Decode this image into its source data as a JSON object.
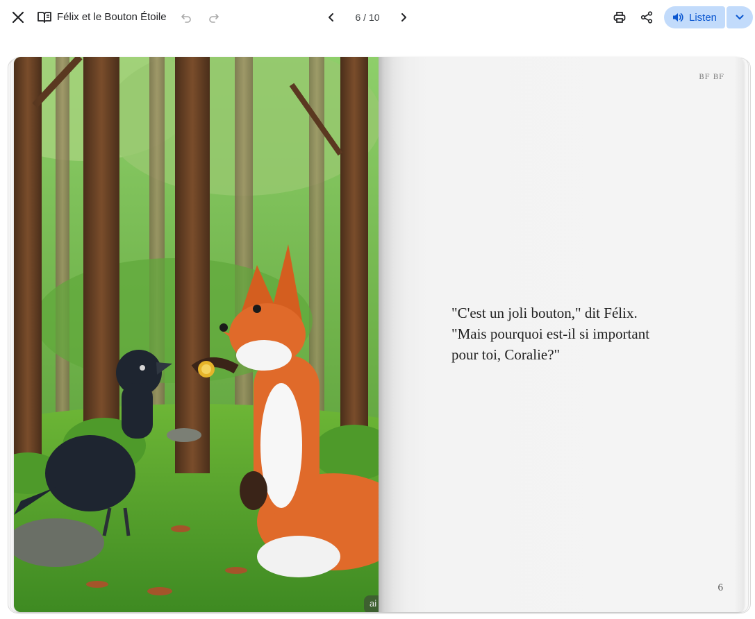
{
  "toolbar": {
    "book_title": "Félix et le Bouton Étoile",
    "page_counter": "6 / 10",
    "listen_label": "Listen",
    "icons": {
      "close": "close-icon",
      "book": "book-icon",
      "undo": "undo-icon",
      "redo": "redo-icon",
      "prev": "chevron-left-icon",
      "next": "chevron-right-icon",
      "print": "print-icon",
      "share": "share-icon",
      "listen": "speaker-icon",
      "listen_menu": "chevron-down-icon"
    },
    "colors": {
      "listen_bg": "#c2dbfb",
      "listen_fg": "#0b57d0"
    }
  },
  "book": {
    "left_page": {
      "illustration": "illustration-fox-and-crow-in-forest",
      "badge": "ai"
    },
    "right_page": {
      "corner_mark": "BF BF",
      "text_lines": [
        "\"C'est un joli bouton,\" dit Félix.",
        "\"Mais pourquoi est-il si important",
        "pour toi, Coralie?\""
      ],
      "page_number": "6"
    }
  }
}
